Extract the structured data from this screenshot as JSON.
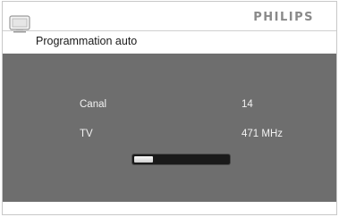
{
  "header": {
    "brand": "PHILIPS",
    "title": "Programmation auto",
    "icon": "tv-icon"
  },
  "info": {
    "channel_label": "Canal",
    "channel_value": "14",
    "tv_label": "TV",
    "tv_value": "471 MHz"
  },
  "progress": {
    "fraction": 0.2
  },
  "colors": {
    "panel": "#6e6e6e",
    "text_light": "#f2f2f2",
    "brand": "#8a8a8a"
  }
}
